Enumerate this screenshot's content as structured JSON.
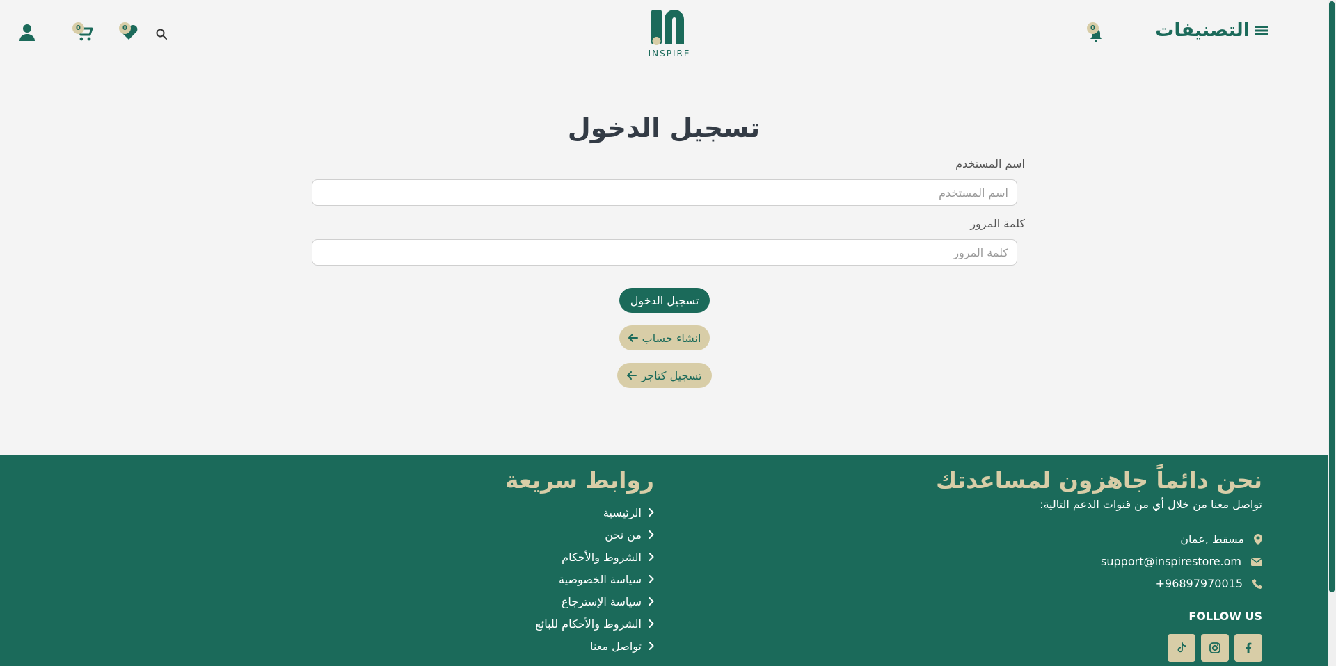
{
  "header": {
    "categories_label": "التصنيفات",
    "notifications_count": "0",
    "wishlist_count": "0",
    "cart_count": "0",
    "logo_text": "INSPIRE"
  },
  "login": {
    "title": "تسجيل الدخول",
    "username_label": "اسم المستخدم",
    "username_placeholder": "اسم المستخدم",
    "password_label": "كلمة المرور",
    "password_placeholder": "كلمة المرور",
    "submit_label": "تسجيل الدخول",
    "create_account_label": "انشاء حساب",
    "register_seller_label": "تسجيل كتاجر"
  },
  "footer": {
    "help_title": "نحن دائماً جاهزون لمساعدتك",
    "help_subtitle": "تواصل معنا من خلال أي من قنوات الدعم التالية:",
    "location": "مسقط ,عمان",
    "email": "support@inspirestore.om",
    "phone": "+96897970015",
    "follow_us": "FOLLOW US",
    "quick_links_title": "روابط سريعة",
    "quick_links": [
      "الرئيسية",
      "من نحن",
      "الشروط والأحكام",
      "سياسة الخصوصية",
      "سياسة الإسترجاع",
      "الشروط والأحكام للبائع",
      "تواصل معنا"
    ]
  },
  "colors": {
    "primary": "#1b6a5a",
    "accent": "#d8cda7",
    "background": "#f4f4f4"
  },
  "icons": [
    "menu-icon",
    "bell-icon",
    "user-icon",
    "cart-icon",
    "heart-icon",
    "search-icon",
    "location-icon",
    "mail-icon",
    "phone-icon",
    "chevron-right-icon",
    "arrow-left-icon",
    "tiktok-icon",
    "instagram-icon",
    "facebook-icon"
  ]
}
